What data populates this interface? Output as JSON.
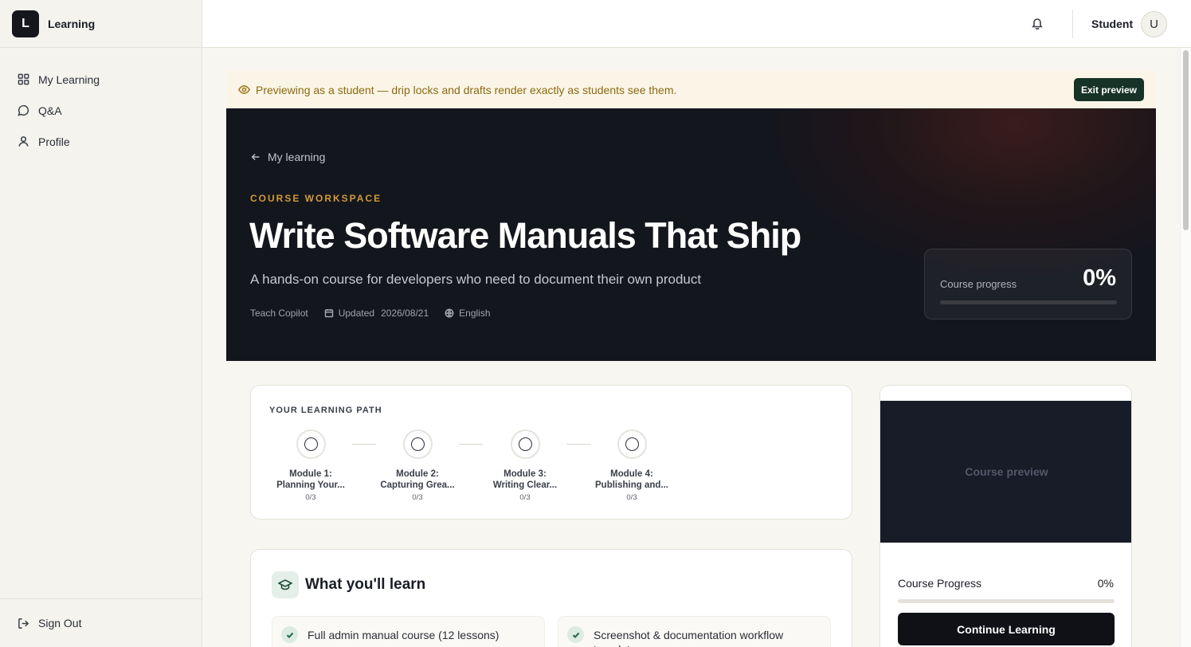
{
  "app": {
    "logo_letter": "L",
    "name": "Learning"
  },
  "sidebar": {
    "items": [
      {
        "label": "My Learning",
        "icon": "grid-icon"
      },
      {
        "label": "Q&A",
        "icon": "chat-bubble-icon"
      },
      {
        "label": "Profile",
        "icon": "user-icon"
      }
    ],
    "sign_out": "Sign Out"
  },
  "topbar": {
    "user_name": "Student",
    "avatar_letter": "U"
  },
  "preview_banner": {
    "text": "Previewing as a student — drip locks and drafts render exactly as students see them.",
    "exit_label": "Exit preview"
  },
  "hero": {
    "back_label": "My learning",
    "eyebrow": "COURSE WORKSPACE",
    "title": "Write Software Manuals That Ship",
    "subtitle": "A hands-on course for developers who need to document their own product",
    "author": "Teach Copilot",
    "updated_label": "Updated",
    "updated_date": "2026/08/21",
    "language": "English",
    "progress_label": "Course progress",
    "progress_value": "0%",
    "progress_fraction": 0
  },
  "learning_path": {
    "title": "YOUR LEARNING PATH",
    "steps": [
      {
        "line1": "Module 1:",
        "line2": "Planning Your...",
        "count": "0/3"
      },
      {
        "line1": "Module 2:",
        "line2": "Capturing Grea...",
        "count": "0/3"
      },
      {
        "line1": "Module 3:",
        "line2": "Writing Clear...",
        "count": "0/3"
      },
      {
        "line1": "Module 4:",
        "line2": "Publishing and...",
        "count": "0/3"
      }
    ]
  },
  "learn": {
    "title": "What you'll learn",
    "items": [
      "Full admin manual course (12 lessons)",
      "Screenshot & documentation workflow templates"
    ]
  },
  "side_card": {
    "video_label": "Course preview",
    "progress_label": "Course Progress",
    "progress_value": "0%",
    "progress_fraction": 0,
    "cta": "Continue Learning"
  },
  "colors": {
    "accent_gold": "#d19a3a",
    "brand_dark_green": "#173226",
    "hero_bg": "#13151b",
    "banner_bg": "#faf5e7"
  }
}
